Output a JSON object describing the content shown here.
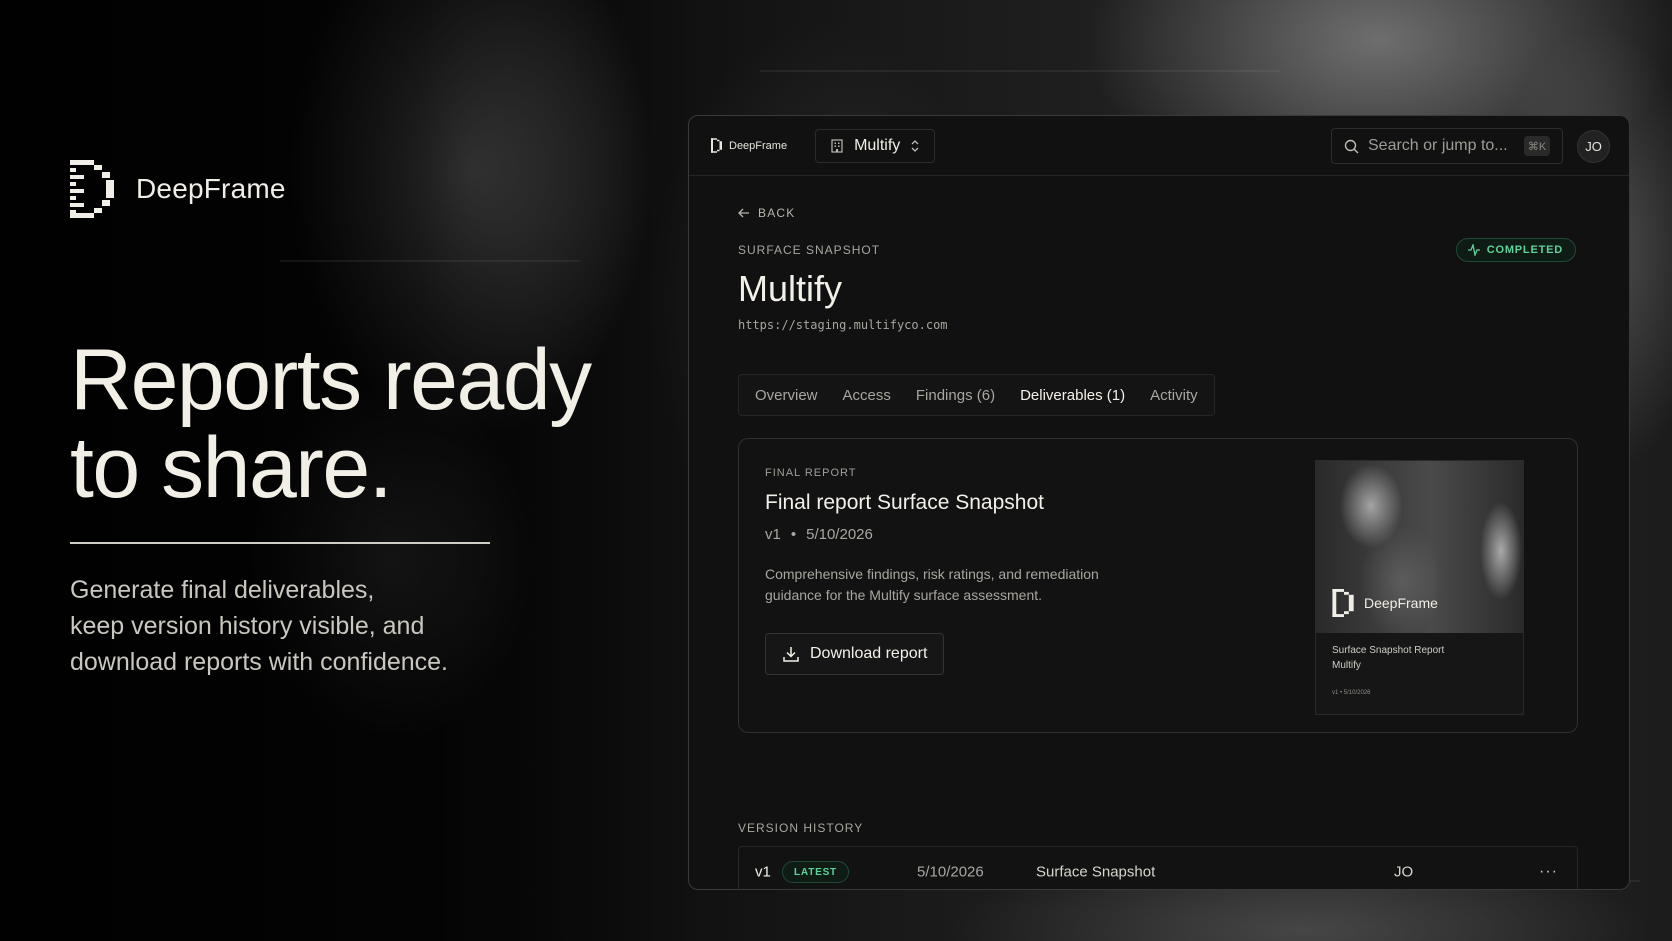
{
  "brand": {
    "name": "DeepFrame"
  },
  "hero": {
    "headline_line1": "Reports ready",
    "headline_line2": "to share.",
    "subcopy_line1": "Generate final deliverables,",
    "subcopy_line2": "keep version history visible, and",
    "subcopy_line3": "download reports with confidence."
  },
  "app": {
    "logo_name": "DeepFrame",
    "workspace": "Multify",
    "search_placeholder": "Search or jump to...",
    "search_shortcut": "⌘K",
    "avatar_initials": "JO"
  },
  "page": {
    "back_label": "BACK",
    "eyebrow": "SURFACE SNAPSHOT",
    "title": "Multify",
    "url": "https://staging.multifyco.com",
    "status": "COMPLETED",
    "status_color": "#5fd39a",
    "tabs": [
      {
        "label": "Overview",
        "active": false
      },
      {
        "label": "Access",
        "active": false
      },
      {
        "label": "Findings (6)",
        "active": false
      },
      {
        "label": "Deliverables (1)",
        "active": true
      },
      {
        "label": "Activity",
        "active": false
      }
    ]
  },
  "report": {
    "eyebrow": "FINAL REPORT",
    "title": "Final report Surface Snapshot",
    "version": "v1",
    "separator": "•",
    "date": "5/10/2026",
    "description": "Comprehensive findings, risk ratings, and remediation guidance for the Multify surface assessment.",
    "download_label": "Download report",
    "thumbnail": {
      "brand": "DeepFrame",
      "line1": "Surface Snapshot Report",
      "line2": "Multify",
      "line3": "v1 • 5/10/2026"
    }
  },
  "version_history": {
    "label": "VERSION HISTORY",
    "rows": [
      {
        "version": "v1",
        "badge": "LATEST",
        "date": "5/10/2026",
        "type": "Surface Snapshot",
        "user": "JO",
        "more": "···"
      }
    ]
  }
}
